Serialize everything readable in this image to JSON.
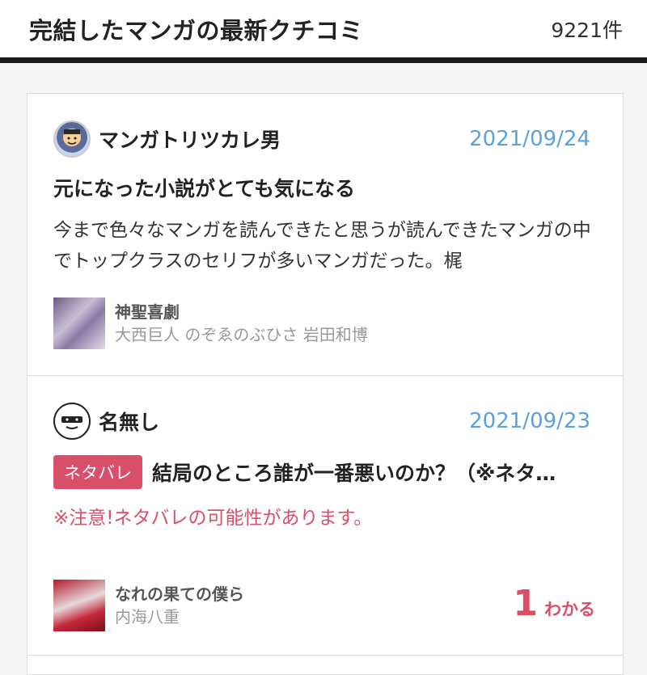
{
  "header": {
    "title": "完結したマンガの最新クチコミ",
    "count": "9221件"
  },
  "reviews": [
    {
      "username": "マンガトリツカレ男",
      "date": "2021/09/24",
      "title": "元になった小説がとても気になる",
      "body": "今まで色々なマンガを読んできたと思うが読んできたマンガの中でトップクラスのセリフが多いマンガだった。梶",
      "book_title": "神聖喜劇",
      "book_authors": "大西巨人 のぞゑのぶひさ 岩田和博"
    },
    {
      "username": "名無し",
      "date": "2021/09/23",
      "spoiler_badge": "ネタバレ",
      "title": "結局のところ誰が一番悪いのか？（※ネタ…",
      "warning": "※注意!ネタバレの可能性があります。",
      "book_title": "なれの果ての僕ら",
      "book_authors": "内海八重",
      "helpful_count": "1",
      "helpful_label": "わかる"
    }
  ],
  "colors": {
    "accent_blue": "#5aa2dd",
    "spoiler_red": "#d94f6a"
  }
}
